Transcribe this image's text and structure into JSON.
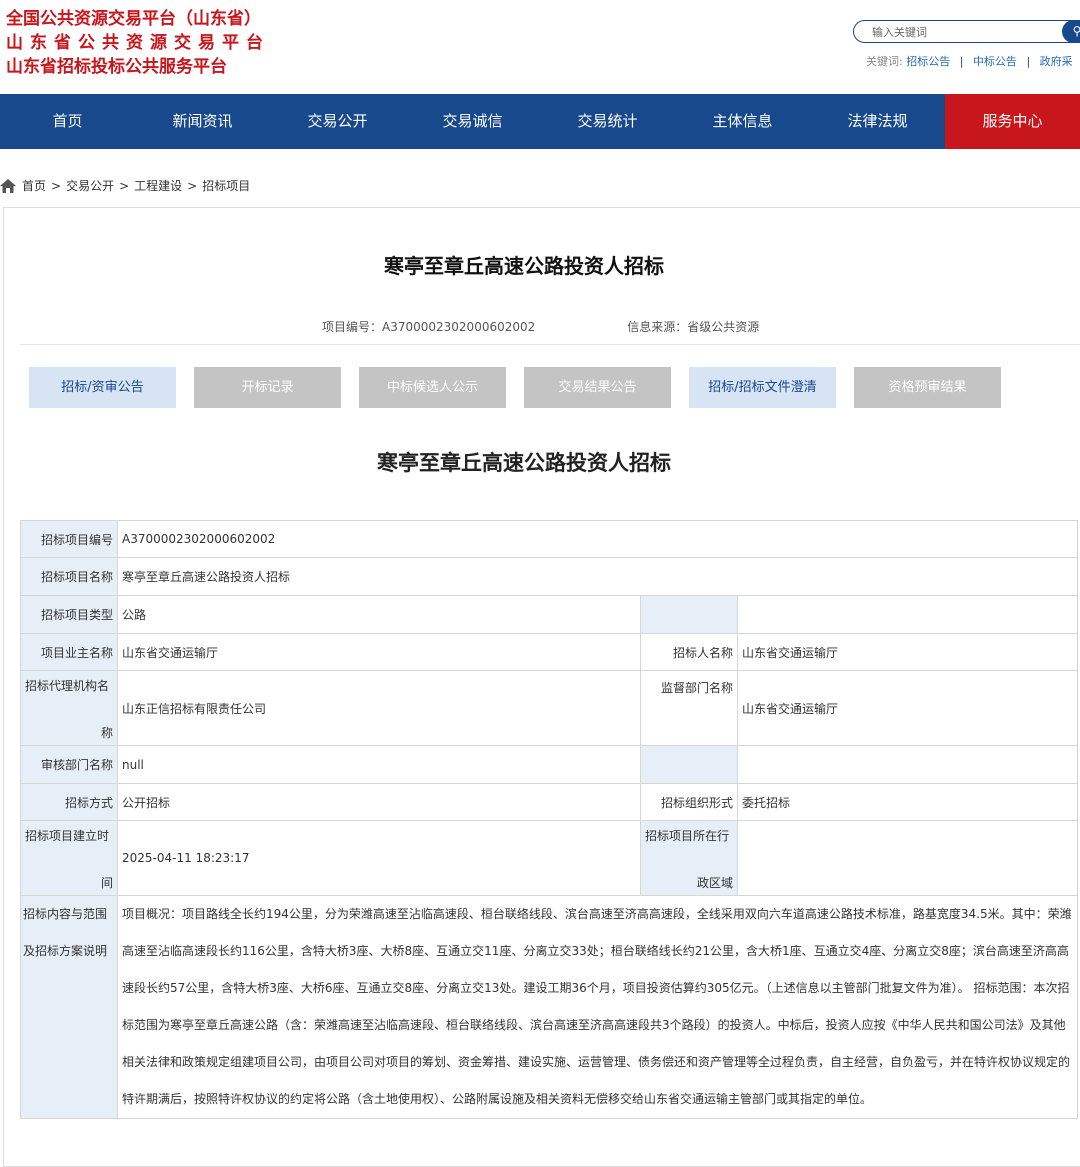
{
  "header": {
    "logo_lines": [
      "全国公共资源交易平台（山东省）",
      "山东省公共资源交易平台",
      "山东省招标投标公共服务平台"
    ],
    "search_placeholder": "输入关键词",
    "keywords_label": "关键词:",
    "keywords": [
      "招标公告",
      "中标公告",
      "政府采"
    ]
  },
  "nav": [
    {
      "label": "首页"
    },
    {
      "label": "新闻资讯"
    },
    {
      "label": "交易公开"
    },
    {
      "label": "交易诚信"
    },
    {
      "label": "交易统计"
    },
    {
      "label": "主体信息"
    },
    {
      "label": "法律法规"
    },
    {
      "label": "服务中心"
    }
  ],
  "breadcrumb": [
    "首页",
    "交易公开",
    "工程建设",
    "招标项目"
  ],
  "title": "寒亭至章丘高速公路投资人招标",
  "meta": {
    "project_no": "项目编号：A3700002302000602002",
    "source": "信息来源：省级公共资源"
  },
  "tabs": [
    {
      "label": "招标/资审公告",
      "active": true
    },
    {
      "label": "开标记录",
      "active": false
    },
    {
      "label": "中标候选人公示",
      "active": false
    },
    {
      "label": "交易结果公告",
      "active": false
    },
    {
      "label": "招标/招标文件澄清",
      "active": true
    },
    {
      "label": "资格预审结果",
      "active": false
    }
  ],
  "subtitle": "寒亭至章丘高速公路投资人招标",
  "table": {
    "project_no_label": "招标项目编号",
    "project_no": "A3700002302000602002",
    "project_name_label": "招标项目名称",
    "project_name": "寒亭至章丘高速公路投资人招标",
    "project_type_label": "招标项目类型",
    "project_type": "公路",
    "owner_label": "项目业主名称",
    "owner": "山东省交通运输厅",
    "tenderer_label": "招标人名称",
    "tenderer": "山东省交通运输厅",
    "agency_label_1": "招标代理机构名",
    "agency_label_2": "称",
    "agency": "山东正信招标有限责任公司",
    "supervisor_label": "监督部门名称",
    "supervisor": "山东省交通运输厅",
    "review_label": "审核部门名称",
    "review": "null",
    "method_label": "招标方式",
    "method": "公开招标",
    "org_label": "招标组织形式",
    "org": "委托招标",
    "created_label_1": "招标项目建立时",
    "created_label_2": "间",
    "created": "2025-04-11 18:23:17",
    "region_label_1": "招标项目所在行",
    "region_label_2": "政区域",
    "region": "",
    "content_label": "招标内容与范围及招标方案说明",
    "content": "项目概况：项目路线全长约194公里，分为荣潍高速至沾临高速段、桓台联络线段、滨台高速至济高高速段，全线采用双向六车道高速公路技术标准，路基宽度34.5米。其中：荣潍高速至沾临高速段长约116公里，含特大桥3座、大桥8座、互通立交11座、分离立交33处；桓台联络线长约21公里，含大桥1座、互通立交4座、分离立交8座；滨台高速至济高高速段长约57公里，含特大桥3座、大桥6座、互通立交8座、分离立交13处。建设工期36个月，项目投资估算约305亿元。（上述信息以主管部门批复文件为准）。 招标范围：本次招标范围为寒亭至章丘高速公路（含：荣潍高速至沾临高速段、桓台联络线段、滨台高速至济高高速段共3个路段）的投资人。中标后，投资人应按《中华人民共和国公司法》及其他相关法律和政策规定组建项目公司，由项目公司对项目的筹划、资金筹措、建设实施、运营管理、债务偿还和资产管理等全过程负责，自主经营，自负盈亏，并在特许权协议规定的特许期满后，按照特许权协议的约定将公路（含土地使用权）、公路附属设施及相关资料无偿移交给山东省交通运输主管部门或其指定的单位。"
  }
}
